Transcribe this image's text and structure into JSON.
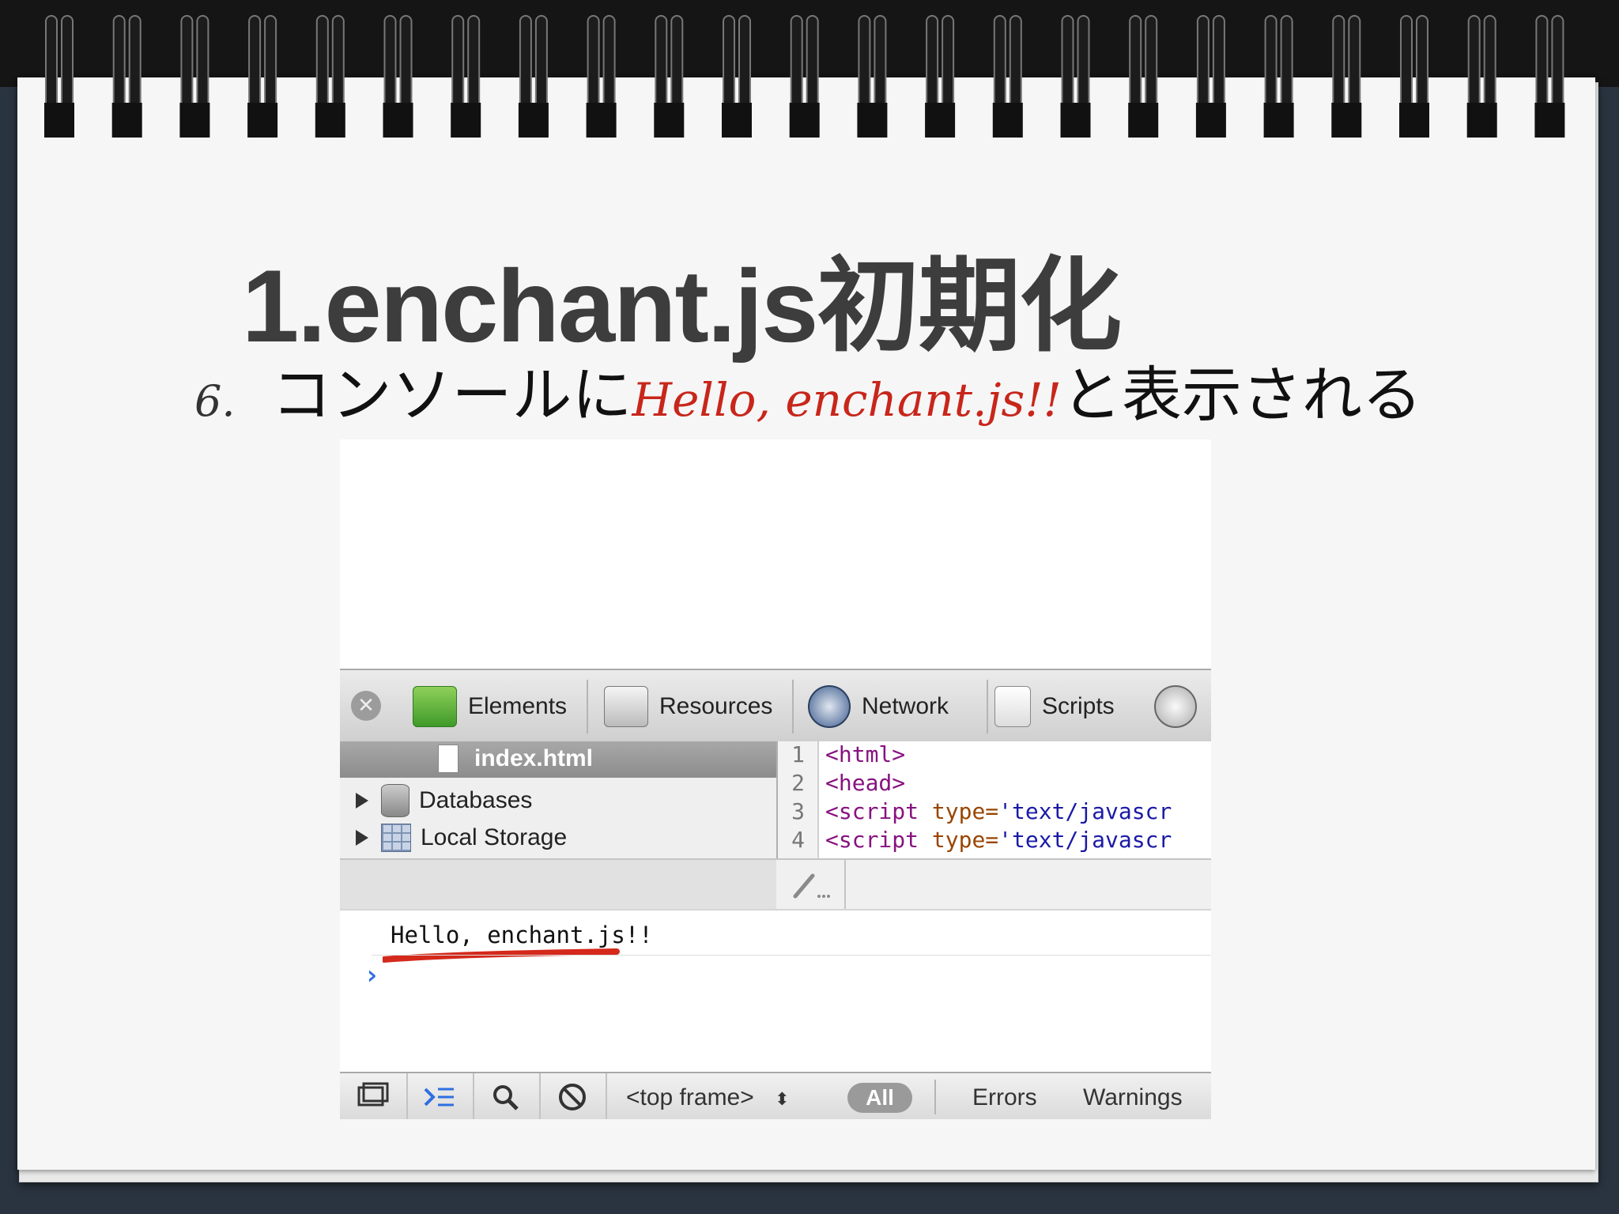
{
  "slide": {
    "title": "1.enchant.js初期化",
    "bullet_number": "6.",
    "bullet_prefix": "コンソールに",
    "bullet_highlight": "Hello, enchant.js!!",
    "bullet_suffix": "と表示される",
    "highlight_color": "#c8261b"
  },
  "inspector": {
    "tabs": [
      {
        "label": "Elements",
        "icon": "elements-icon"
      },
      {
        "label": "Resources",
        "icon": "resources-icon"
      },
      {
        "label": "Network",
        "icon": "network-icon"
      },
      {
        "label": "Scripts",
        "icon": "scripts-icon"
      }
    ],
    "resources_tree": {
      "selected_file": "index.html",
      "items": [
        {
          "label": "Databases"
        },
        {
          "label": "Local Storage"
        }
      ]
    },
    "code_lines": [
      {
        "num": "1",
        "text": "<html>"
      },
      {
        "num": "2",
        "text": "<head>"
      },
      {
        "num": "3",
        "tag": "<script",
        "attr": " type=",
        "val": "'text/javascr"
      },
      {
        "num": "4",
        "tag": "<script",
        "attr": " type=",
        "val": "'text/javascr"
      }
    ],
    "console": {
      "message": "Hello, enchant.js!!",
      "prompt": "›"
    },
    "status_bar": {
      "frame_select": "<top frame>",
      "filters": {
        "all": "All",
        "errors": "Errors",
        "warnings": "Warnings"
      }
    }
  }
}
